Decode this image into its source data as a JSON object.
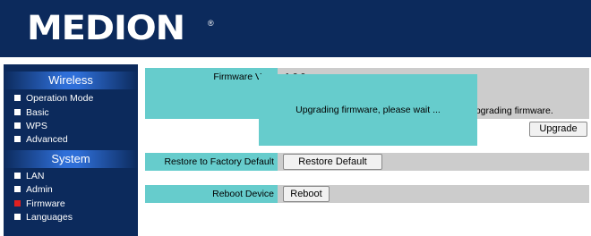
{
  "header": {
    "logo_text": "MEDION",
    "logo_mark": "®"
  },
  "sidebar": {
    "sections": [
      {
        "title": "Wireless",
        "items": [
          {
            "label": "Operation Mode",
            "active": false
          },
          {
            "label": "Basic",
            "active": false
          },
          {
            "label": "WPS",
            "active": false
          },
          {
            "label": "Advanced",
            "active": false
          }
        ]
      },
      {
        "title": "System",
        "items": [
          {
            "label": "LAN",
            "active": false
          },
          {
            "label": "Admin",
            "active": false
          },
          {
            "label": "Firmware",
            "active": true
          },
          {
            "label": "Languages",
            "active": false
          }
        ]
      }
    ]
  },
  "firmware": {
    "version_label": "Firmware Vers",
    "version_value": "1.0.0",
    "upgrade_description_visible": "upgrading firmware.",
    "upgrade_button": "Upgrade"
  },
  "restore": {
    "label": "Restore to Factory Default",
    "button": "Restore Default"
  },
  "reboot": {
    "label": "Reboot Device",
    "button": "Reboot"
  },
  "overlay": {
    "message": "Upgrading firmware, please wait ..."
  },
  "colors": {
    "header_bg": "#0c2a5c",
    "teal": "#66cccc",
    "gray": "#cccccc",
    "active_marker": "#e02020"
  }
}
